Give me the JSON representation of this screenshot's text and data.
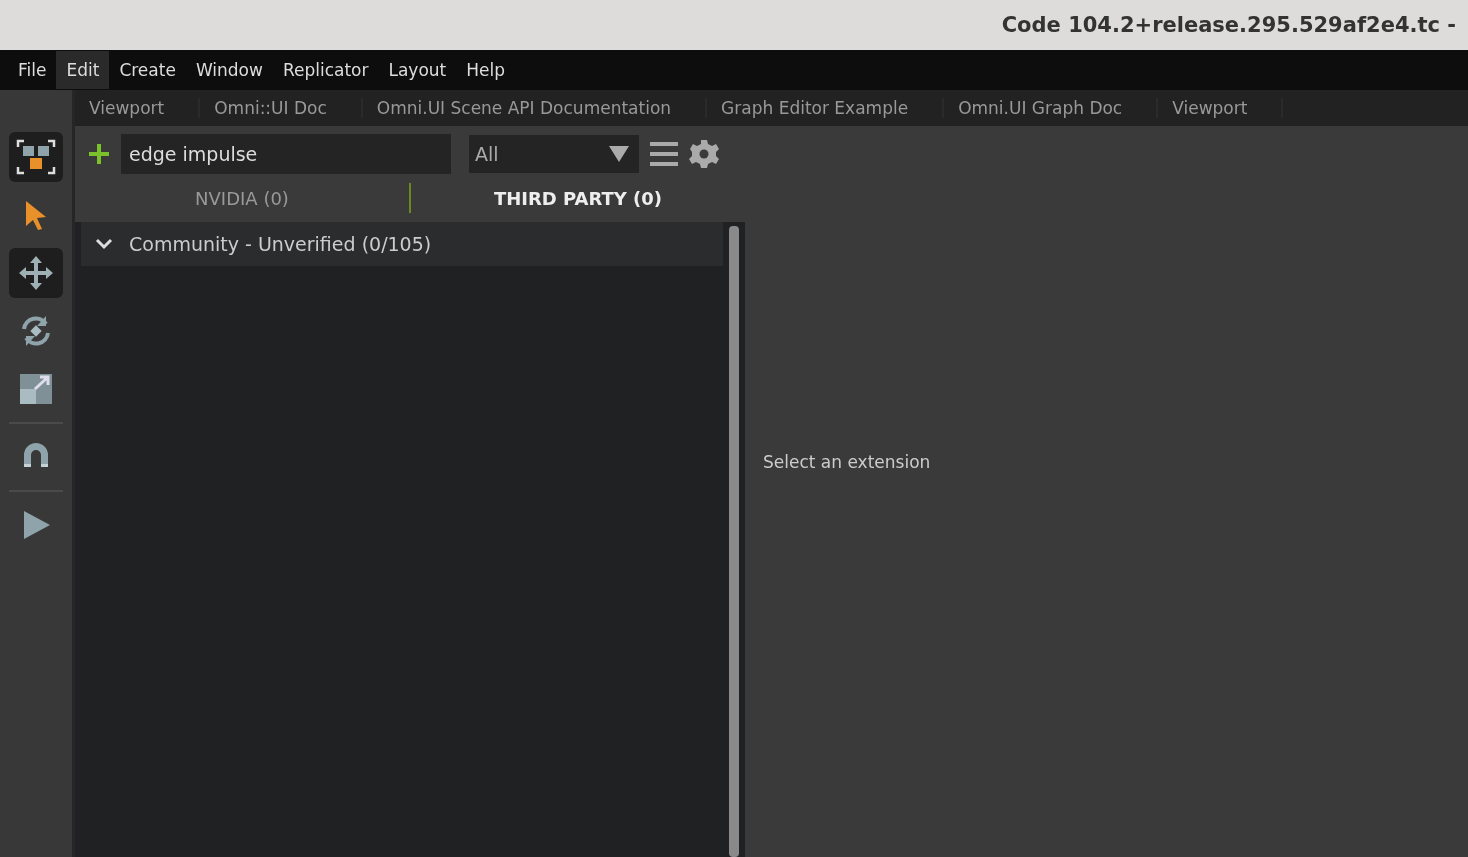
{
  "window": {
    "title": "Code 104.2+release.295.529af2e4.tc -"
  },
  "menu": [
    {
      "label": "File",
      "hovered": false
    },
    {
      "label": "Edit",
      "hovered": true
    },
    {
      "label": "Create",
      "hovered": false
    },
    {
      "label": "Window",
      "hovered": false
    },
    {
      "label": "Replicator",
      "hovered": false
    },
    {
      "label": "Layout",
      "hovered": false
    },
    {
      "label": "Help",
      "hovered": false
    }
  ],
  "toolbar": [
    {
      "kind": "frame",
      "highlighted": true,
      "selected": false
    },
    {
      "kind": "select",
      "highlighted": false,
      "selected": true
    },
    {
      "kind": "move",
      "highlighted": true,
      "selected": false
    },
    {
      "kind": "rotate",
      "highlighted": false,
      "selected": false
    },
    {
      "kind": "scale",
      "highlighted": false,
      "selected": false
    },
    {
      "kind": "snap",
      "highlighted": false,
      "selected": false
    },
    {
      "kind": "play",
      "highlighted": false,
      "selected": false
    }
  ],
  "tabs": [
    "Viewport",
    "Omni::UI Doc",
    "Omni.UI Scene API Documentation",
    "Graph Editor Example",
    "Omni.UI Graph Doc",
    "Viewport"
  ],
  "extensions": {
    "search": {
      "value": "edge impulse"
    },
    "filter": {
      "value": "All"
    },
    "source_tabs": [
      {
        "label": "NVIDIA (0)",
        "selected": false
      },
      {
        "label": "THIRD PARTY (0)",
        "selected": true
      }
    ],
    "groups": [
      {
        "label": "Community - Unverified (0/105)",
        "expanded": true
      }
    ]
  },
  "details": {
    "message": "Select an extension"
  }
}
